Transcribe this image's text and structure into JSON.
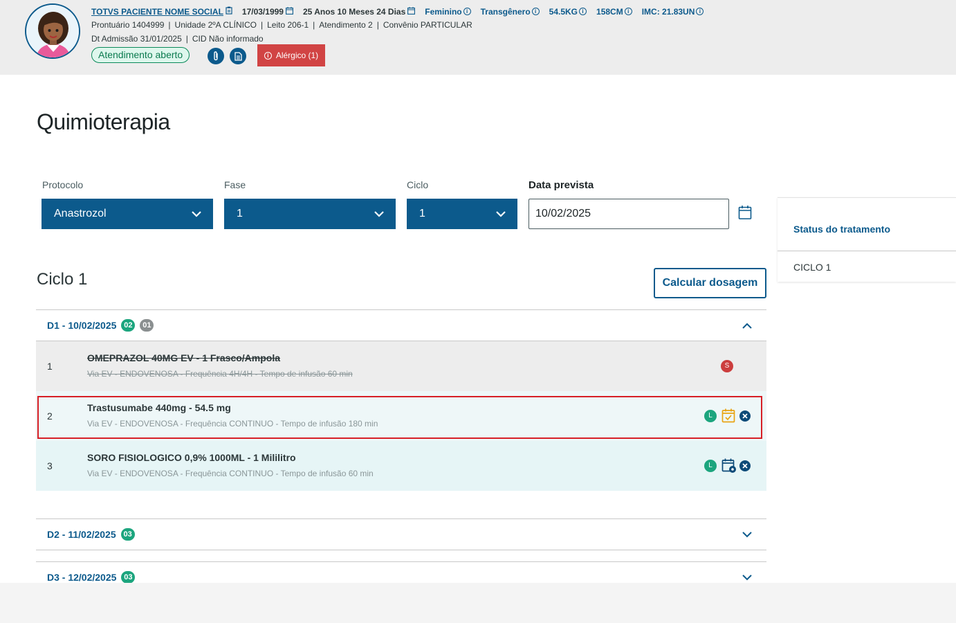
{
  "patient": {
    "name": "TOTVS PACIENTE NOME SOCIAL",
    "birth_date": "17/03/1999",
    "age": "25 Anos 10 Meses 24 Dias",
    "sex": "Feminino",
    "gender": "Transgênero",
    "weight": "54.5KG",
    "height": "158CM",
    "imc": "IMC: 21.83UN",
    "prontuario": "Prontuário 1404999",
    "unidade": "Unidade 2ºA CLÍNICO",
    "leito": "Leito 206-1",
    "atendimento": "Atendimento 2",
    "convenio": "Convênio PARTICULAR",
    "admissao": "Dt Admissão 31/01/2025",
    "cid": "CID Não informado",
    "status_badge": "Atendimento aberto",
    "allergy_label": "Alérgico (1)"
  },
  "page": {
    "title": "Quimioterapia",
    "cycle_title": "Ciclo 1",
    "calc_button": "Calcular dosagem"
  },
  "filters": {
    "protocolo_label": "Protocolo",
    "protocolo_value": "Anastrozol",
    "fase_label": "Fase",
    "fase_value": "1",
    "ciclo_label": "Ciclo",
    "ciclo_value": "1",
    "data_label": "Data prevista",
    "data_value": "10/02/2025"
  },
  "side_panel": {
    "title": "Status do tratamento",
    "item": "CICLO 1"
  },
  "days": [
    {
      "label": "D1 - 10/02/2025",
      "badges": [
        "02",
        "01"
      ],
      "expanded": true
    },
    {
      "label": "D2 - 11/02/2025",
      "badges": [
        "03"
      ],
      "expanded": false
    },
    {
      "label": "D3 - 12/02/2025",
      "badges": [
        "03"
      ],
      "expanded": false
    }
  ],
  "items": [
    {
      "num": "1",
      "title": "OMEPRAZOL 40MG EV - 1 Frasco/Ampola",
      "sub": "Via EV - ENDOVENOSA - Frequência 4H/4H - Tempo de infusão 60 min",
      "status": "S",
      "status_color": "#cc3e3e"
    },
    {
      "num": "2",
      "title": "Trastusumabe 440mg - 54.5 mg",
      "sub": "Via EV - ENDOVENOSA - Frequência CONTINUO - Tempo de infusão 180 min",
      "status": "L",
      "status_color": "#1ca57e"
    },
    {
      "num": "3",
      "title": "SORO FISIOLOGICO 0,9% 1000ML - 1 Mililitro",
      "sub": "Via EV - ENDOVENOSA - Frequência CONTINUO - Tempo de infusão 60 min",
      "status": "L",
      "status_color": "#1ca57e"
    }
  ],
  "colors": {
    "primary": "#0c5a8c",
    "danger": "#d14444",
    "success": "#1ca57e"
  }
}
